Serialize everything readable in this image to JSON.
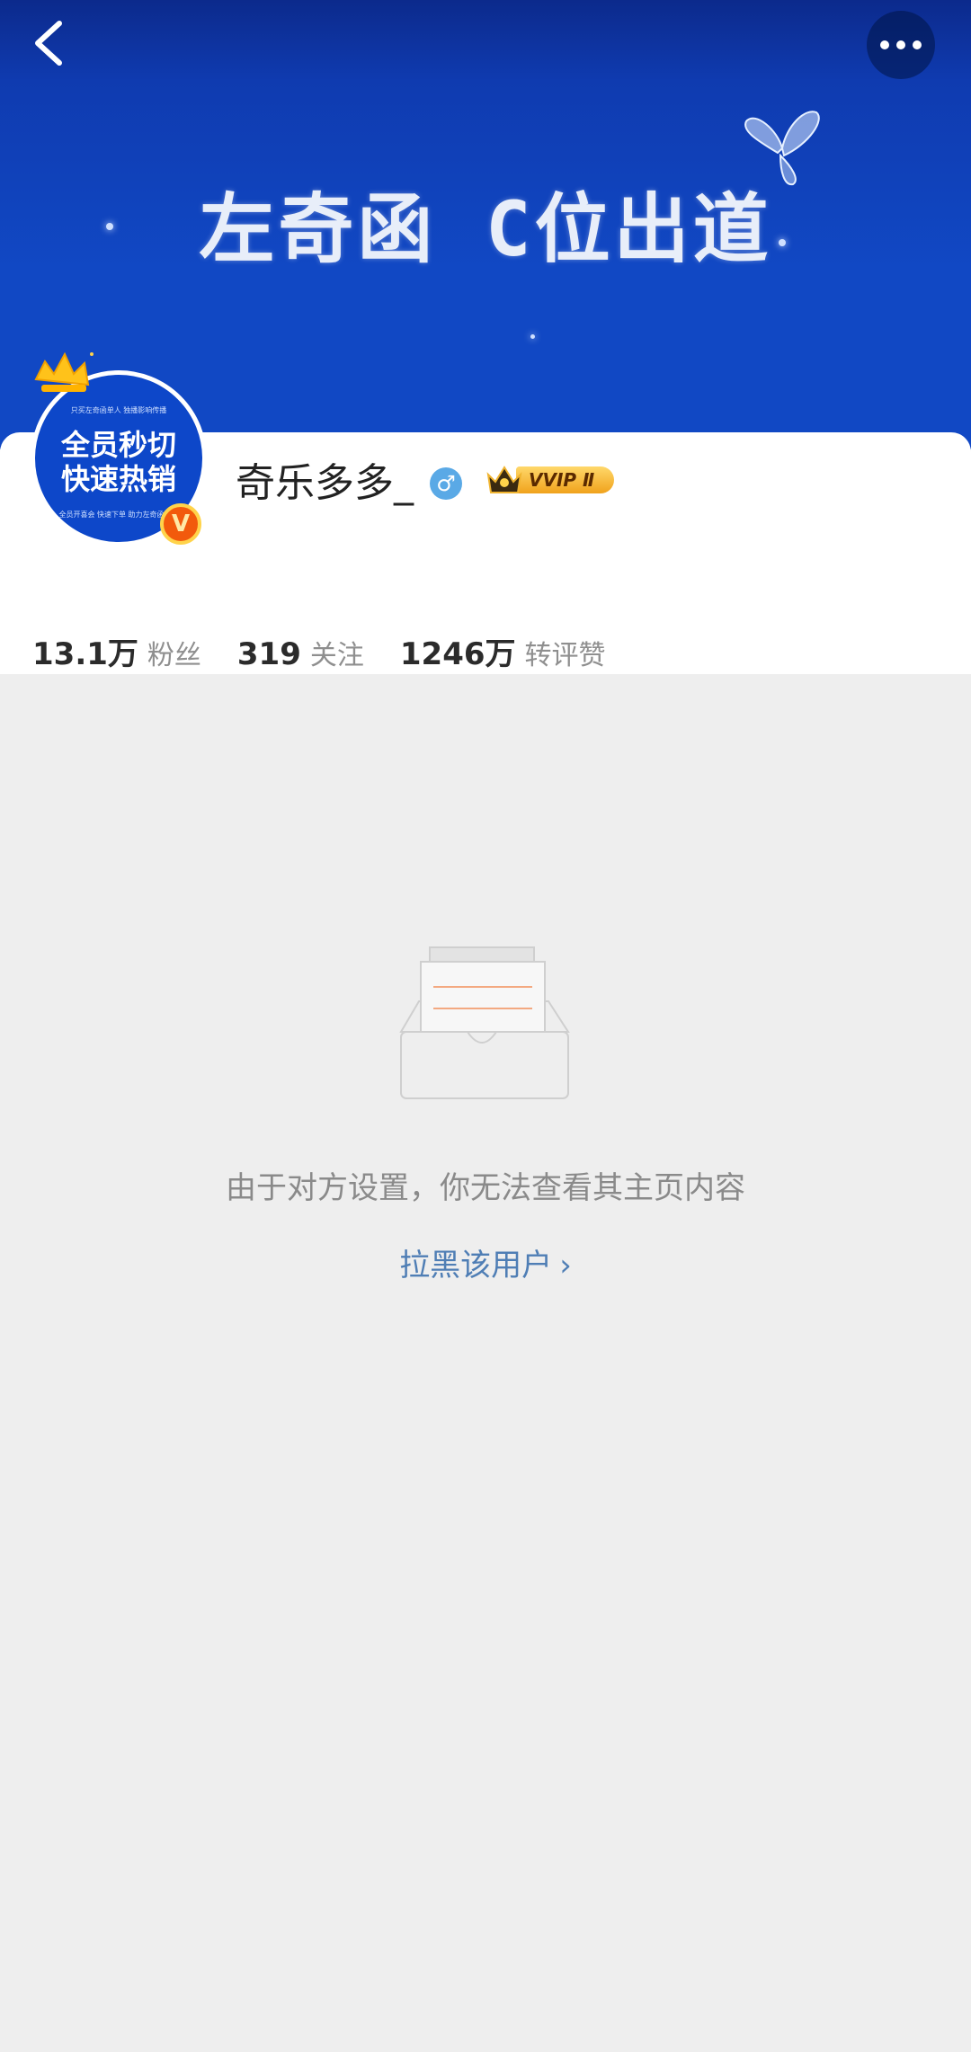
{
  "banner": {
    "title": "左奇函 C位出道"
  },
  "header": {
    "back_icon": "chevron-left-icon",
    "more_icon": "more-dots-icon"
  },
  "avatar": {
    "line1": "全员秒切",
    "line2": "快速热销",
    "small_top": "只买左奇函单人   独播影响传播",
    "small_bottom": "全员开喜会 快速下单   助力左奇函单人",
    "verified_badge": "V"
  },
  "profile": {
    "username": "奇乐多多_",
    "gender_symbol": "♂",
    "vvip_label": "VVIP Ⅱ"
  },
  "stats": [
    {
      "value": "13.1万",
      "label": "粉丝"
    },
    {
      "value": "319",
      "label": "关注"
    },
    {
      "value": "1246万",
      "label": "转评赞"
    }
  ],
  "empty_state": {
    "message": "由于对方设置，你无法查看其主页内容",
    "action_label": "拉黑该用户",
    "action_chevron": "›"
  },
  "colors": {
    "banner_blue": "#1148c4",
    "link_blue": "#4f7eb5",
    "page_bg": "#eeeeee"
  }
}
